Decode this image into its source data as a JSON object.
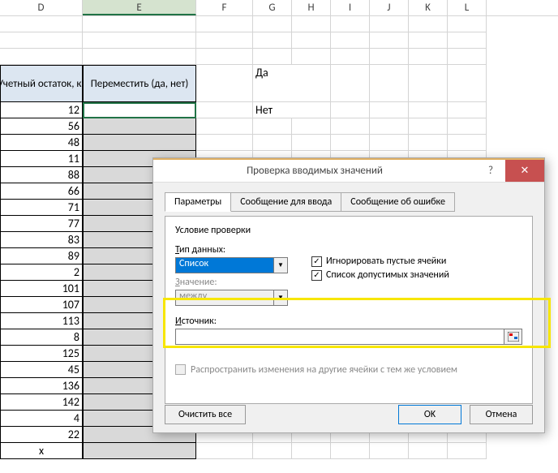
{
  "columns": {
    "D": "D",
    "E": "E",
    "F": "F",
    "G": "G",
    "H": "H",
    "I": "I",
    "J": "J",
    "K": "K",
    "L": "L"
  },
  "table_headers": {
    "D": "Учетный остаток, кг",
    "E": "Переместить (да, нет)"
  },
  "column_d_values": [
    "12",
    "56",
    "48",
    "11",
    "88",
    "66",
    "71",
    "77",
    "83",
    "89",
    "2",
    "101",
    "107",
    "113",
    "8",
    "125",
    "45",
    "136",
    "142",
    "4",
    "22",
    "x"
  ],
  "side_values": {
    "g1": "Да",
    "g2": "Нет"
  },
  "dialog": {
    "title": "Проверка вводимых значений",
    "tabs": {
      "params": "Параметры",
      "input_msg": "Сообщение для ввода",
      "error_msg": "Сообщение об ошибке"
    },
    "group": "Условие проверки",
    "type_label": "Тип данных:",
    "type_value": "Список",
    "value_label": "Значение:",
    "value_value": "между",
    "ignore_blank": "Игнорировать пустые ячейки",
    "list_values": "Список допустимых значений",
    "source_label": "Источник:",
    "source_value": "",
    "propagate": "Распространить изменения на другие ячейки с тем же условием",
    "clear_all": "Очистить все",
    "ok": "OK",
    "cancel": "Отмена",
    "help": "?",
    "close": "✕"
  }
}
